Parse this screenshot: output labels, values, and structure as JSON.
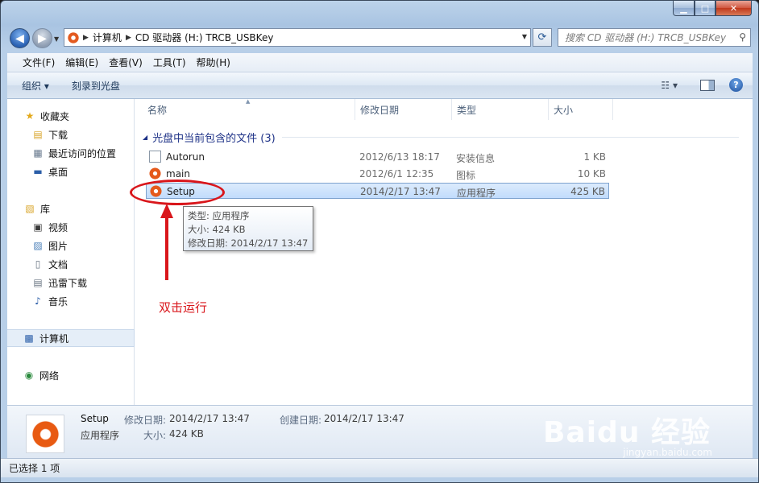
{
  "address_bar": {
    "segments": [
      "计算机",
      "CD 驱动器 (H:) TRCB_USBKey"
    ]
  },
  "search": {
    "placeholder": "搜索 CD 驱动器 (H:) TRCB_USBKey"
  },
  "menu": [
    "文件(F)",
    "编辑(E)",
    "查看(V)",
    "工具(T)",
    "帮助(H)"
  ],
  "toolbar": {
    "organize": "组织 ▾",
    "burn": "刻录到光盘"
  },
  "nav": {
    "favorites": "收藏夹",
    "downloads": "下载",
    "recent": "最近访问的位置",
    "desktop": "桌面",
    "libraries": "库",
    "videos": "视频",
    "pictures": "图片",
    "documents": "文档",
    "thunder": "迅雷下载",
    "music": "音乐",
    "computer": "计算机",
    "network": "网络"
  },
  "columns": {
    "name": "名称",
    "date": "修改日期",
    "type": "类型",
    "size": "大小"
  },
  "group_header": "光盘中当前包含的文件 (3)",
  "files": [
    {
      "name": "Autorun",
      "date": "2012/6/13 18:17",
      "type": "安装信息",
      "size": "1 KB",
      "icon": "setup-info-icon"
    },
    {
      "name": "main",
      "date": "2012/6/1 12:35",
      "type": "图标",
      "size": "10 KB",
      "icon": "app-icon"
    },
    {
      "name": "Setup",
      "date": "2014/2/17 13:47",
      "type": "应用程序",
      "size": "425 KB",
      "icon": "app-icon"
    }
  ],
  "tooltip": {
    "type": "类型: 应用程序",
    "size": "大小: 424 KB",
    "modified": "修改日期: 2014/2/17 13:47"
  },
  "annotation": "双击运行",
  "details": {
    "name": "Setup",
    "type": "应用程序",
    "modified_label": "修改日期:",
    "modified": "2014/2/17 13:47",
    "created_label": "创建日期:",
    "created": "2014/2/17 13:47",
    "size_label": "大小:",
    "size": "424 KB"
  },
  "watermark": {
    "logo": "Baidu 经验",
    "url": "jingyan.baidu.com"
  },
  "status": "已选择 1 项",
  "colors": {
    "annotation_red": "#d9161b",
    "app_orange": "#e55a1c"
  }
}
